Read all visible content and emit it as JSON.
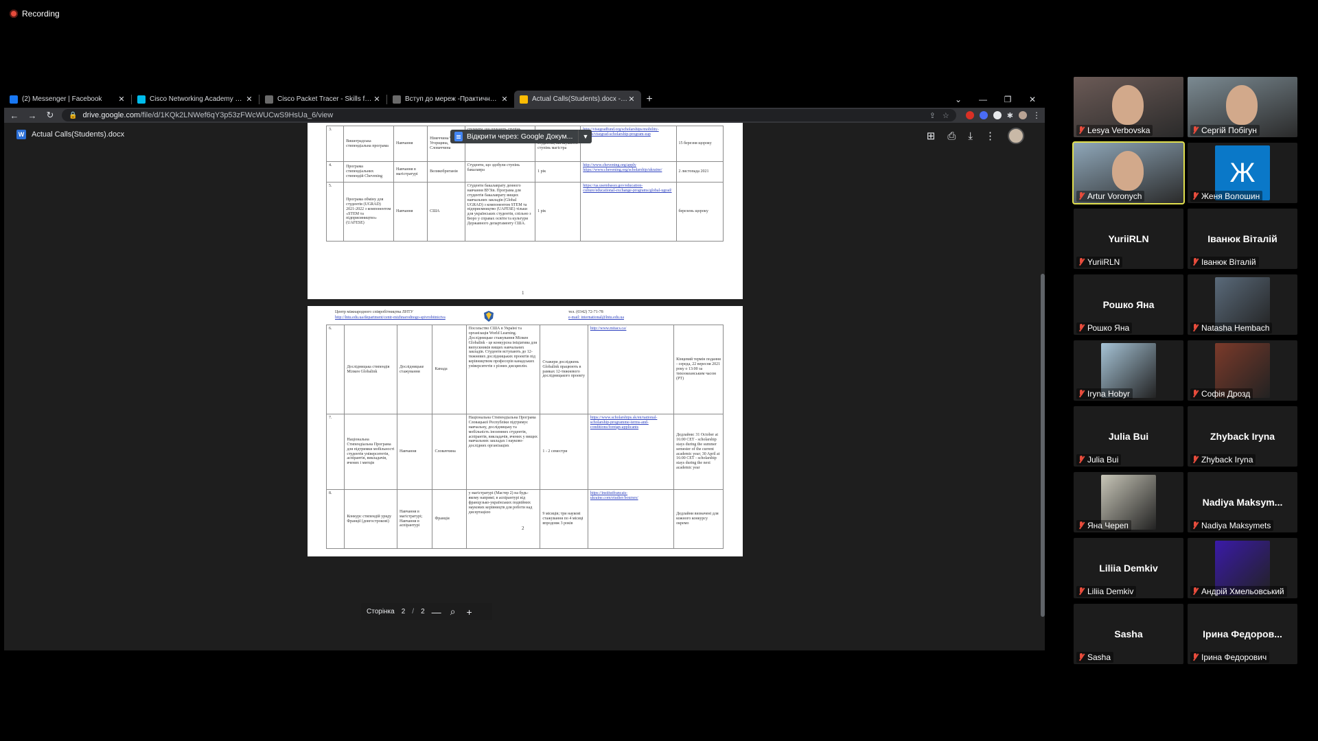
{
  "recording": {
    "label": "Recording"
  },
  "browser": {
    "tabs": [
      {
        "title": "(2) Messenger | Facebook",
        "icon": "facebook-icon",
        "color": "#1877f2",
        "active": false
      },
      {
        "title": "Cisco Networking Academy Buil...",
        "icon": "cisco-icon",
        "color": "#00bceb",
        "active": false
      },
      {
        "title": "Cisco Packet Tracer - Skills for All",
        "icon": "packet-tracer-icon",
        "color": "#6a6a6a",
        "active": false
      },
      {
        "title": "Вступ до мереж -Практичне за...",
        "icon": "document-icon",
        "color": "#6a6a6a",
        "active": false
      },
      {
        "title": "Actual Calls(Students).docx - Goo...",
        "icon": "google-drive-icon",
        "color": "#fbbc04",
        "active": true
      }
    ],
    "url_host": "drive.google.com",
    "url_path": "/file/d/1KQk2LNWef6qY3p53zFWcWUCwS9HsUa_6/view"
  },
  "viewer": {
    "doc_name": "Actual Calls(Students).docx",
    "open_with_label": "Відкрити через: Google Докум...",
    "page_label": "Сторінка",
    "current_page": "2",
    "page_sep": "/",
    "total_pages": "2"
  },
  "page1": {
    "rows": [
      {
        "num": "3.",
        "program": "Вишеградська стипендіальна програма",
        "type": "Навчання",
        "country": "Німеччина Чехія, Угорщина, Словаччина",
        "who": "студенти, що шукають ступінь магістра",
        "term": "2 семестри для студентів, які шукають ступінь магістра",
        "link": "http://visegradfund.org/scholarships/mobility-grants/visegrad-scholarship-program-eap",
        "deadline": "15 березня щороку"
      },
      {
        "num": "4.",
        "program": "Програма стипендіальних стипендій Chevening",
        "type": "Навчання в магістратурі",
        "country": "Великобританія",
        "who": "Студенти, що здобули ступінь бакалавра",
        "term": "1 рік",
        "link": "http://www.chevening.org/apply https://www.chevening.org/scholarship/ukraine/",
        "deadline": "2 листопада 2021"
      },
      {
        "num": "5.",
        "program": "Програма обміну для студентів (UGRAD) 2021-2022 з компонентом «STEM та підприємництво» (UAFESE)",
        "type": "Навчання",
        "country": "США",
        "who": "Студенти бакалаврату денного навчання ВУЗів. Програма для студентів бакалаврату вищих навчальних закладів (Global UGRAD) з компонентом STEM та підприємництво (UAFESE) тільки для українських студентів, спільно з Бюро у справах освіти та культури Державного департаменту США.",
        "term": "1 рік",
        "link": "https://ua.usembassy.gov/education-culture/educational-exchange-programs/global-ugrad/",
        "deadline": "березень щороку"
      }
    ],
    "page_num": "1"
  },
  "page2": {
    "header_left": "Центр міжнародного співробітництва ЛНТУ",
    "header_left_link": "http://lntu.edu.ua/department/centr-mizhnarodnogo-spivrobitnictva",
    "header_right": "тел. (0342) 72-71-78",
    "header_right_link": "e-mail: international@lntu.edu.ua",
    "rows": [
      {
        "num": "6.",
        "program": "Дослідницька стипендія Мілкен Globalink",
        "type": "Дослідницьке стажування",
        "country": "Канада",
        "who": "Посольство США в Україні та організація World Learning. Дослідницьке стажування Мілкен Globalink - це конкурсна ініціатива для випускників вищих навчальних закладів. Студенти вступають до 12-тижневих дослідницьких проектів під керівництвом професорів канадських університетів з різних дисциплін.",
        "term": "Стажери досліджень Globalink працюють в рамках 12-тижневого дослідницького проекту",
        "link": "http://www.mitacs.ca/",
        "deadline": "Кінцевий термін подання - середа, 22 вересня 2021 року о 13:00 за тихоокеанським часом (PT)"
      },
      {
        "num": "7.",
        "program": "Національна Стипендіальна Програма для підтримки мобільності студентів університетів, аспірантів, викладачів, вчених і митців",
        "type": "Навчання",
        "country": "Словаччина",
        "who": "Національна Стипендіальна Програма Словацької Республіки підтримує навчальну, дослідницьку та мобільність іноземних студентів, аспірантів, викладачів, вчених у вищих навчальних закладах і науково-дослідних організаціях",
        "term": "1 - 2 семестри",
        "link": "https://www.scholarships.sk/en/national-scholarship-programme-terms-and-conditions/foreign-applicants",
        "deadline": "Дедлайни: 31 October at 16:00 CET - scholarship stays during the summer semester of the current academic year; 30 April at 16:00 CET - scholarship stays during the next academic year"
      },
      {
        "num": "8.",
        "program": "Конкурс стипендій уряду Франції (довгострокові)",
        "type": "Навчання в магістратурі; Навчання в аспірантурі",
        "country": "Франція",
        "who": "у магістратурі (Мастер 2) на будь-якому напрямі; в аспірантурі від французько-українських подвійних наукових керівництв для роботи над дисертацією",
        "term": "9 місяців; три наукові стажування по 4 місяці впродовж 3 років",
        "link": "https://institutfrancais-ukraine.com/etudier/bourses/",
        "deadline": "Дедлайни визначені для кожного конкурсу окремо"
      }
    ],
    "page_num": "2"
  },
  "participants": [
    {
      "name": "Lesya Verbovska",
      "video": true,
      "tone": "#6b5a56"
    },
    {
      "name": "Сергій Побігун",
      "video": true,
      "tone": "#7b8a92"
    },
    {
      "name": "Artur Voronych",
      "video": true,
      "tone": "#8fa7b9",
      "active": true
    },
    {
      "name": "Женя Волошин",
      "avatar_letter": "Ж",
      "avatar_color": "#0a78c8"
    },
    {
      "name": "YuriiRLN",
      "center": "YuriiRLN"
    },
    {
      "name": "Іванюк Віталій",
      "center": "Іванюк Віталій"
    },
    {
      "name": "Рошко Яна",
      "center": "Рошко Яна"
    },
    {
      "name": "Natasha Hembach",
      "thumb": true,
      "tone": "#5a6a7a"
    },
    {
      "name": "Iryna Hobyr",
      "thumb": true,
      "tone": "#a6c3d6"
    },
    {
      "name": "Софія Дрозд",
      "thumb": true,
      "tone": "#7b3a2a"
    },
    {
      "name": "Julia Bui",
      "center": "Julia Bui"
    },
    {
      "name": "Zhyback Iryna",
      "center": "Zhyback Iryna"
    },
    {
      "name": "Яна Череп",
      "thumb": true,
      "tone": "#c8c6b8"
    },
    {
      "name": "Nadiya Maksymets",
      "center": "Nadiya Maksym..."
    },
    {
      "name": "Liliia Demkiv",
      "center": "Liliia Demkiv"
    },
    {
      "name": "Андрій Хмельовський",
      "thumb": true,
      "tone": "#3a1aa8"
    },
    {
      "name": "Sasha",
      "center": "Sasha"
    },
    {
      "name": "Ірина Федорович",
      "center": "Ірина Федоров..."
    }
  ]
}
